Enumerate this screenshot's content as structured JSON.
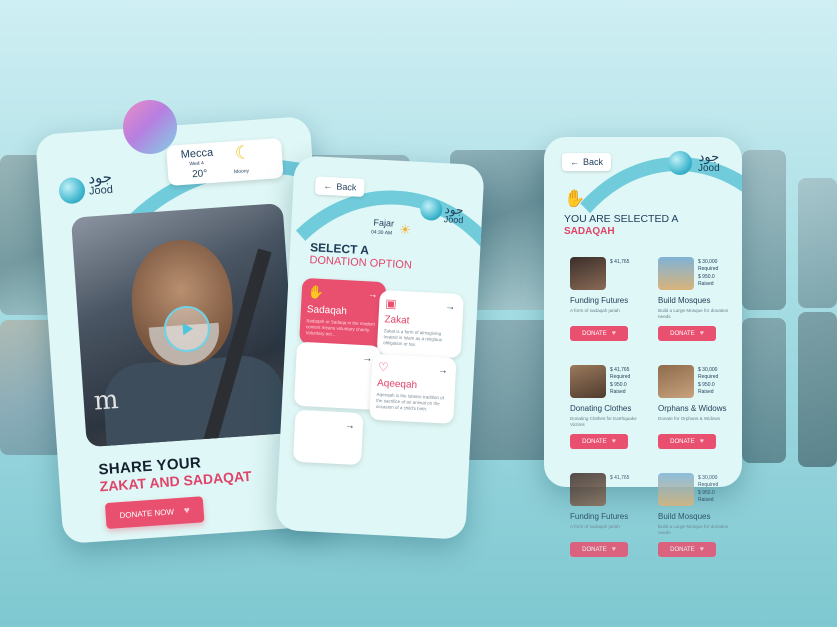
{
  "logo": {
    "arabic": "جود",
    "name": "Jood"
  },
  "phone1": {
    "city": "Mecca",
    "day": "Wed 4",
    "temp": "20°",
    "weather_label": "Moony",
    "watermark": "m",
    "headline_1": "SHARE YOUR",
    "headline_2": "ZAKAT AND SADAQAT",
    "donate_label": "DONATE NOW"
  },
  "phone2": {
    "back_label": "Back",
    "prayer": "Fajar",
    "time": "04:30 AM",
    "title_1": "SELECT A",
    "title_2": "DONATION OPTION",
    "options": [
      {
        "title": "Sadaqah",
        "desc": "Sadaqah or Sadaqa in the modern context means voluntary charity. Voluntary act..."
      },
      {
        "title": "Zakat",
        "desc": "Zakat is a form of almsgiving treated in Islam as a religious obligation or tax."
      },
      {
        "title": "",
        "desc": ""
      },
      {
        "title": "Aqeeqah",
        "desc": "Aqeeqah is the Islamic tradition of the sacrifice of an animal on the occasion of a child's birth."
      }
    ]
  },
  "phone3": {
    "back_label": "Back",
    "title_1": "YOU ARE SELECTED A",
    "title_2": "SADAQAH",
    "donate_label": "DONATE",
    "cards": [
      {
        "name": "Funding Futures",
        "sub": "A form of sadaqah jariah",
        "line1": "$ 41,765",
        "line2": ""
      },
      {
        "name": "Build Mosques",
        "sub": "Build a Large Mosque for donation needs",
        "line1": "$ 30,000",
        "line2": "Required",
        "line3": "$ 950.0",
        "line4": "Raised"
      },
      {
        "name": "Donating Clothes",
        "sub": "Donating Clothes for Earthquake Victims",
        "line1": "$ 41,765",
        "line2": "Required",
        "line3": "$ 950.0",
        "line4": "Raised"
      },
      {
        "name": "Orphans & Widows",
        "sub": "Donate for Orphans & Widows",
        "line1": "$ 30,000",
        "line2": "Required",
        "line3": "$ 950.0",
        "line4": "Raised"
      },
      {
        "name": "Funding Futures",
        "sub": "A form of sadaqah jariah",
        "line1": "$ 41,765",
        "line2": ""
      },
      {
        "name": "Build Mosques",
        "sub": "Build a Large Mosque for donation needs",
        "line1": "$ 30,000",
        "line2": "Required",
        "line3": "$ 950.0",
        "line4": "Raised"
      }
    ]
  },
  "colors": {
    "accent": "#e9506f",
    "navy": "#1e3b57",
    "teal": "#5dc3d6",
    "phone_bg": "#dff7f6"
  }
}
